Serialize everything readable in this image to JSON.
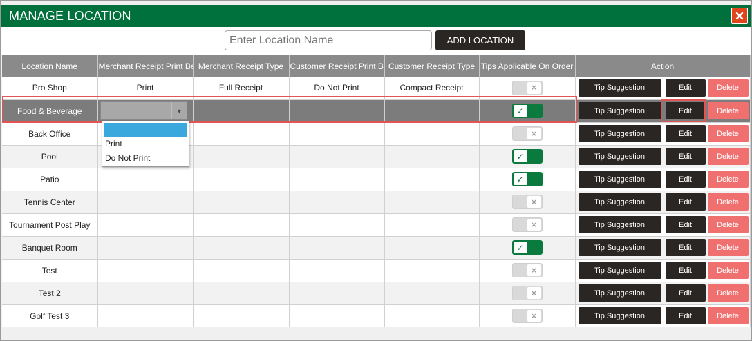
{
  "window": {
    "title": "MANAGE LOCATION",
    "close_icon": "close-icon",
    "accent": "#00713c",
    "close_color": "#e0461d"
  },
  "toolbar": {
    "search_placeholder": "Enter Location Name",
    "search_value": "",
    "add_label": "ADD LOCATION"
  },
  "table": {
    "columns": [
      "Location Name",
      "Merchant Receipt Print Be",
      "Merchant Receipt Type",
      "Customer Receipt Print Be",
      "Customer Receipt Type",
      "Tips Applicable On Order",
      "Action"
    ],
    "action_labels": {
      "tip": "Tip Suggestion",
      "edit": "Edit",
      "delete": "Delete"
    },
    "rows": [
      {
        "name": "Pro Shop",
        "merchant_print": "Print",
        "merchant_type": "Full Receipt",
        "customer_print": "Do Not Print",
        "customer_type": "Compact Receipt",
        "tips": false
      },
      {
        "name": "Food & Beverage",
        "merchant_print": "",
        "merchant_type": "",
        "customer_print": "",
        "customer_type": "",
        "tips": true,
        "editing": true
      },
      {
        "name": "Back Office",
        "merchant_print": "",
        "merchant_type": "",
        "customer_print": "",
        "customer_type": "",
        "tips": false
      },
      {
        "name": "Pool",
        "merchant_print": "",
        "merchant_type": "",
        "customer_print": "",
        "customer_type": "",
        "tips": true
      },
      {
        "name": "Patio",
        "merchant_print": "",
        "merchant_type": "",
        "customer_print": "",
        "customer_type": "",
        "tips": true
      },
      {
        "name": "Tennis Center",
        "merchant_print": "",
        "merchant_type": "",
        "customer_print": "",
        "customer_type": "",
        "tips": false
      },
      {
        "name": "Tournament Post Play",
        "merchant_print": "",
        "merchant_type": "",
        "customer_print": "",
        "customer_type": "",
        "tips": false
      },
      {
        "name": "Banquet Room",
        "merchant_print": "",
        "merchant_type": "",
        "customer_print": "",
        "customer_type": "",
        "tips": true
      },
      {
        "name": "Test",
        "merchant_print": "",
        "merchant_type": "",
        "customer_print": "",
        "customer_type": "",
        "tips": false
      },
      {
        "name": "Test 2",
        "merchant_print": "",
        "merchant_type": "",
        "customer_print": "",
        "customer_type": "",
        "tips": false
      },
      {
        "name": "Golf Test 3",
        "merchant_print": "",
        "merchant_type": "",
        "customer_print": "",
        "customer_type": "",
        "tips": false
      }
    ]
  },
  "dropdown": {
    "selected": "",
    "options": [
      "",
      "Print",
      "Do Not Print"
    ]
  },
  "toggle_icons": {
    "on": "check-icon",
    "off": "x-icon"
  },
  "colors": {
    "editing_row": "#7c7c7c",
    "delete": "#f07070",
    "highlight": "#3aa7dd",
    "annotation": "#e25555"
  }
}
